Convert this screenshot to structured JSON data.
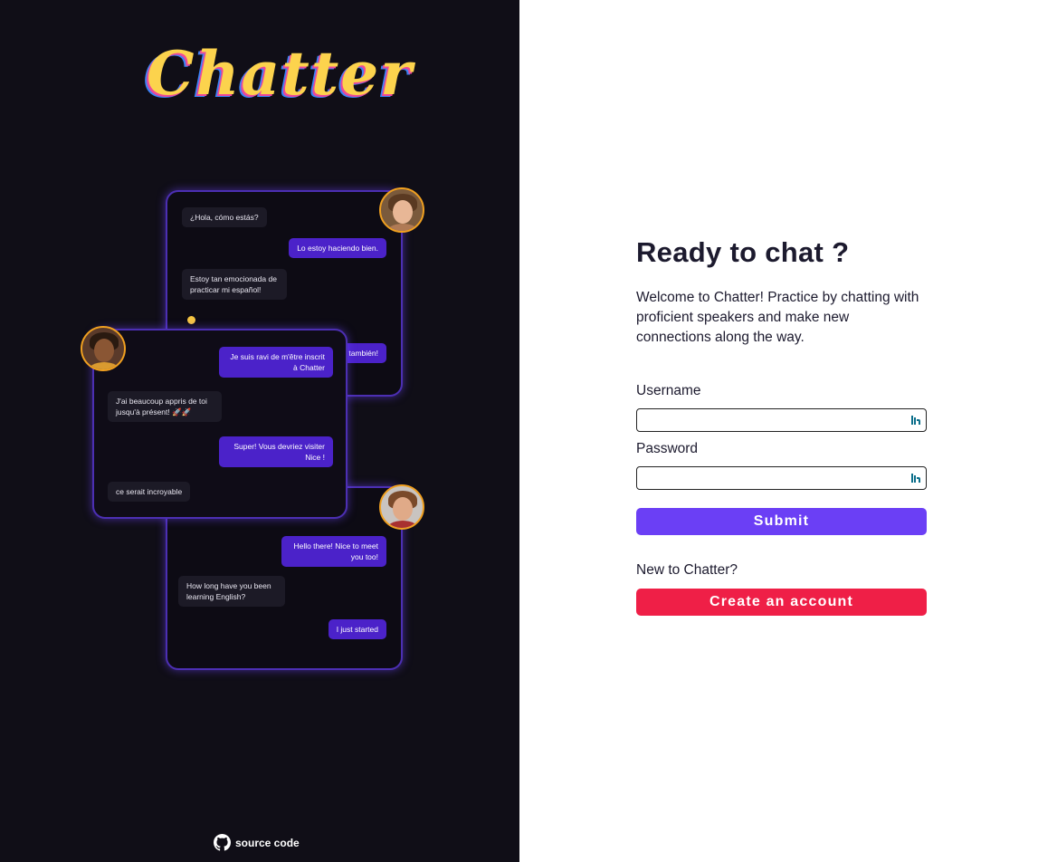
{
  "brand": {
    "name": "Chatter"
  },
  "preview": {
    "top_chat": {
      "messages": [
        {
          "text": "¿Hola, cómo estás?",
          "side": "recv"
        },
        {
          "text": "Lo estoy haciendo bien.",
          "side": "sent"
        },
        {
          "text": "Estoy tan emocionada de practicar mi español!",
          "side": "recv"
        },
        {
          "text": "o también!",
          "side": "sent"
        }
      ]
    },
    "middle_chat": {
      "messages": [
        {
          "text": "Je suis ravi de m'être inscrit à Chatter",
          "side": "sent"
        },
        {
          "text": "J'ai beaucoup appris de toi jusqu'à présent! 🚀🚀",
          "side": "recv"
        },
        {
          "text": "Super! Vous devriez visiter Nice !",
          "side": "sent"
        },
        {
          "text": "ce serait incroyable",
          "side": "recv"
        }
      ]
    },
    "bottom_chat": {
      "messages": [
        {
          "text": "Hello there! Nice to meet you too!",
          "side": "sent"
        },
        {
          "text": "How long have you been learning English?",
          "side": "recv"
        },
        {
          "text": "I just started",
          "side": "sent"
        }
      ]
    }
  },
  "footer": {
    "source_label": "source code",
    "icon": "github-icon"
  },
  "login": {
    "title": "Ready to chat ?",
    "intro": "Welcome to Chatter! Practice by chatting with proficient speakers and make new connections along the way.",
    "username_label": "Username",
    "username_value": "",
    "password_label": "Password",
    "password_value": "",
    "submit_label": "Submit",
    "new_prompt": "New to Chatter?",
    "create_label": "Create an account"
  },
  "colors": {
    "left_bg": "#100e17",
    "submit": "#6b3ff5",
    "create": "#ef1f47",
    "bubble_sent": "#4b22c9",
    "card_border": "#4c2fb3",
    "avatar_ring": "#f0a020"
  }
}
